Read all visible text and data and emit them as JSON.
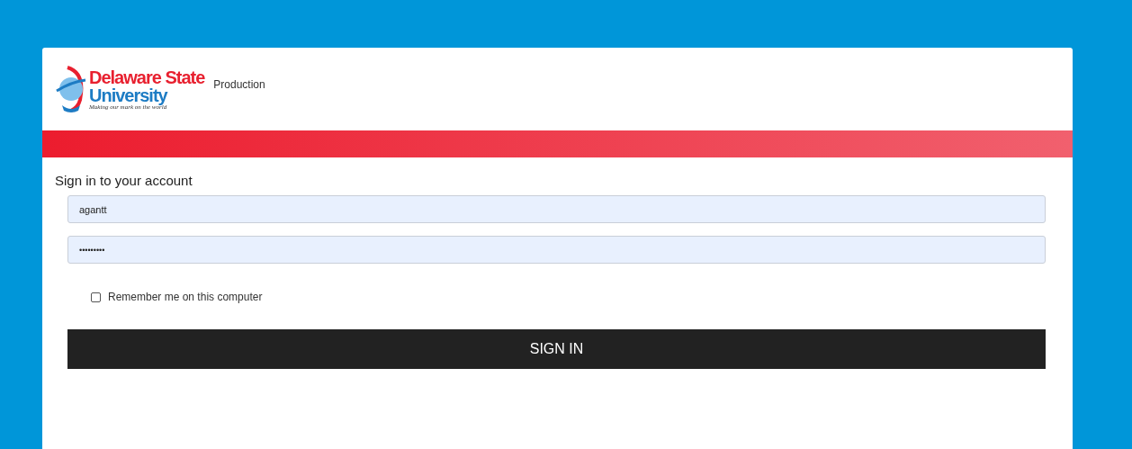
{
  "logo": {
    "line1": "Delaware State",
    "line2": "University",
    "tagline": "Making our mark on the world"
  },
  "environment": "Production",
  "heading": "Sign in to your account",
  "username": {
    "value": "agantt"
  },
  "password": {
    "value": "•••••••••"
  },
  "remember": {
    "label": "Remember me on this computer",
    "checked": false
  },
  "submit": {
    "label": "SIGN IN"
  }
}
